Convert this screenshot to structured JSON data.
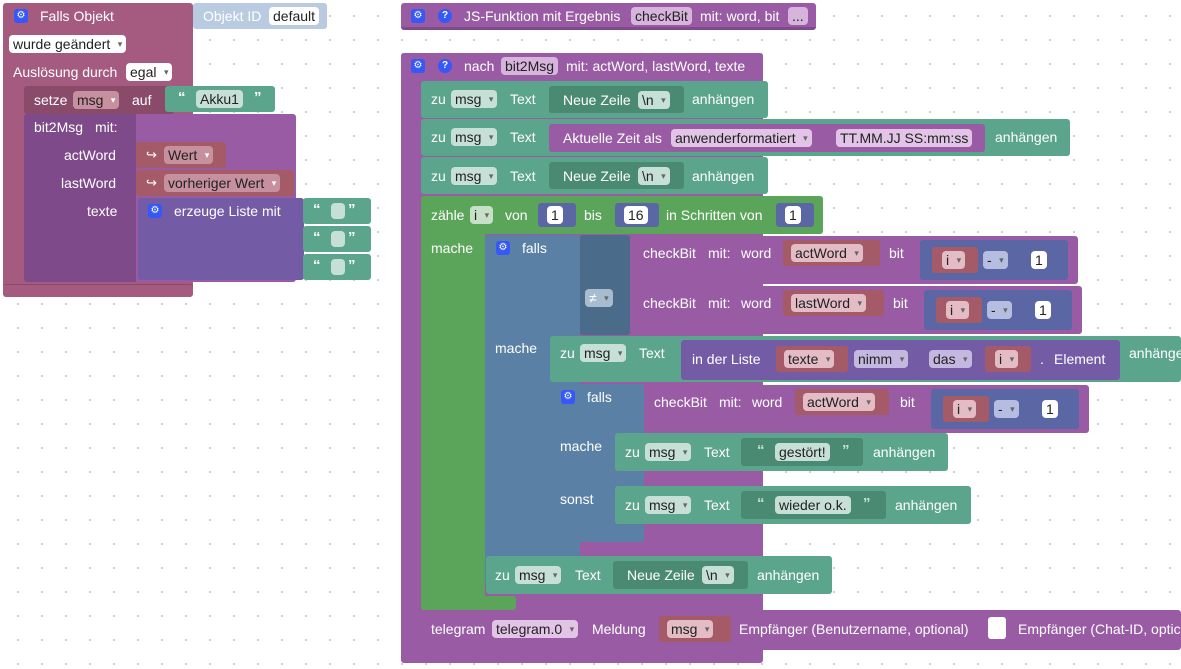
{
  "event_block": {
    "header": "Falls Objekt",
    "object_id_label": "Objekt ID",
    "object_id_value": "default",
    "change_option": "wurde geändert",
    "trigger_label": "Auslösung durch",
    "trigger_option": "egal",
    "set_label": "setze",
    "set_var": "msg",
    "set_to": "auf",
    "set_value": "Akku1",
    "call_name": "bit2Msg",
    "call_with": "mit:",
    "param_actword": "actWord",
    "param_lastword": "lastWord",
    "param_texte": "texte",
    "value_wert": "Wert",
    "value_prev": "vorheriger Wert",
    "list_create": "erzeuge Liste mit"
  },
  "js_function": {
    "title": "JS-Funktion mit Ergebnis",
    "name": "checkBit",
    "params": "mit: word, bit",
    "ellipsis": "..."
  },
  "procedure": {
    "title": "nach",
    "name": "bit2Msg",
    "params": "mit: actWord, lastWord, texte",
    "zu": "zu",
    "msg": "msg",
    "text": "Text",
    "newline": "Neue Zeile",
    "newline_val": "\\n",
    "append": "anhängen",
    "time_label": "Aktuelle Zeit als",
    "time_option": "anwenderformatiert",
    "time_format": "TT.MM.JJ SS:mm:ss",
    "count_label": "zähle",
    "count_var": "i",
    "from": "von",
    "from_val": "1",
    "to": "bis",
    "to_val": "16",
    "step": "in Schritten von",
    "step_val": "1",
    "do": "mache",
    "if": "falls",
    "else": "sonst",
    "checkbit": "checkBit",
    "with": "mit:",
    "word": "word",
    "bit": "bit",
    "actword": "actWord",
    "lastword": "lastWord",
    "minus": "-",
    "one": "1",
    "neq": "≠",
    "in_list": "in der Liste",
    "texte": "texte",
    "take": "nimm",
    "the": "das",
    "element": "Element",
    "dot": ".",
    "append_cut": "anhänge",
    "broken": "gestört!",
    "ok": "wieder o.k.",
    "telegram": "telegram",
    "telegram_inst": "telegram.0",
    "message": "Meldung",
    "recipient_user": "Empfänger (Benutzername, optional)",
    "recipient_chat": "Empfänger (Chat-ID, optic"
  },
  "icons": {
    "gear": "gear-icon",
    "help": "help-icon"
  }
}
